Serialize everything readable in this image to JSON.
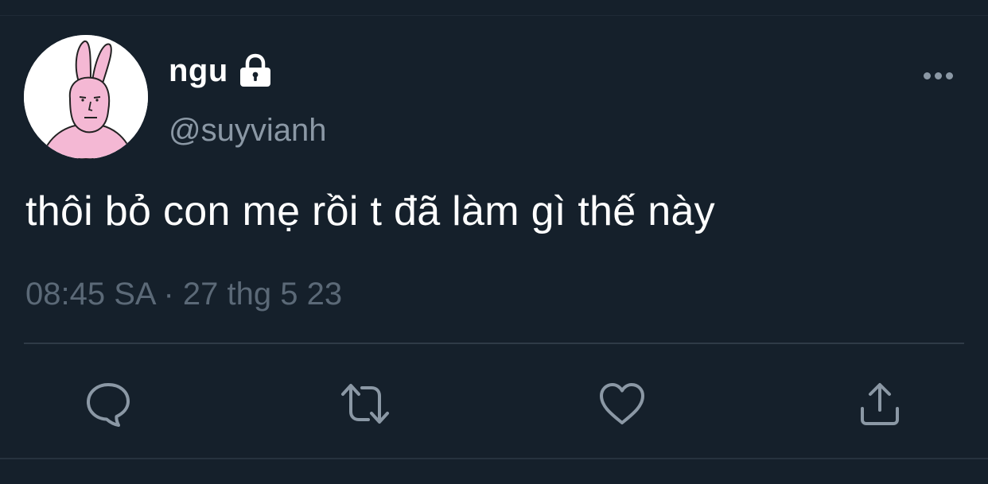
{
  "tweet": {
    "display_name": "ngu",
    "handle": "@suyvianh",
    "text": "thôi bỏ con mẹ rồi t đã làm gì thế này",
    "timestamp": "08:45 SA · 27 thg 5 23",
    "protected_icon": "lock-icon",
    "avatar": "pink-rabbit-avatar"
  },
  "actions": {
    "reply_icon": "speech-bubble-icon",
    "retweet_icon": "retweet-arrows-icon",
    "like_icon": "heart-icon",
    "share_icon": "share-upload-icon",
    "more_icon": "ellipsis-icon"
  },
  "colors": {
    "background": "#15202b",
    "primary_text": "#ffffff",
    "secondary_text": "#8b98a5",
    "timestamp_text": "#5b6977",
    "divider": "#2f3b47",
    "avatar_skin": "#f4b8d4"
  }
}
